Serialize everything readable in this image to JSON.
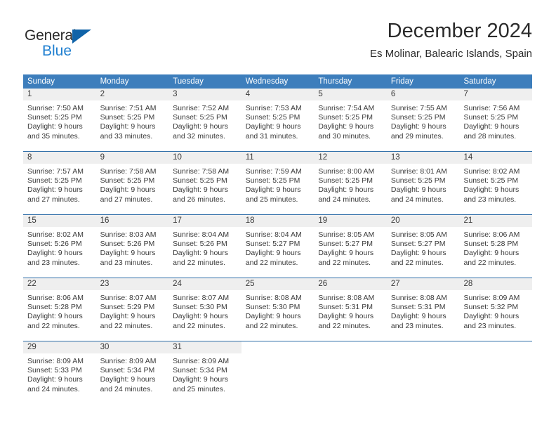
{
  "logo": {
    "word_one": "General",
    "word_two": "Blue",
    "triangle_icon": "triangle-icon",
    "accent_color": "#1063a8",
    "blue_text_color": "#1f7fd0"
  },
  "header": {
    "title": "December 2024",
    "subtitle": "Es Molinar, Balearic Islands, Spain"
  },
  "theme": {
    "header_row_bg": "#3d7ebc",
    "week_divider": "#2f6ea8",
    "day_band_bg": "#efefef",
    "text_color": "#3a3a3a"
  },
  "weekdays": [
    "Sunday",
    "Monday",
    "Tuesday",
    "Wednesday",
    "Thursday",
    "Friday",
    "Saturday"
  ],
  "weeks": [
    [
      {
        "day": "1",
        "sunrise": "Sunrise: 7:50 AM",
        "sunset": "Sunset: 5:25 PM",
        "daylight_line1": "Daylight: 9 hours",
        "daylight_line2": "and 35 minutes."
      },
      {
        "day": "2",
        "sunrise": "Sunrise: 7:51 AM",
        "sunset": "Sunset: 5:25 PM",
        "daylight_line1": "Daylight: 9 hours",
        "daylight_line2": "and 33 minutes."
      },
      {
        "day": "3",
        "sunrise": "Sunrise: 7:52 AM",
        "sunset": "Sunset: 5:25 PM",
        "daylight_line1": "Daylight: 9 hours",
        "daylight_line2": "and 32 minutes."
      },
      {
        "day": "4",
        "sunrise": "Sunrise: 7:53 AM",
        "sunset": "Sunset: 5:25 PM",
        "daylight_line1": "Daylight: 9 hours",
        "daylight_line2": "and 31 minutes."
      },
      {
        "day": "5",
        "sunrise": "Sunrise: 7:54 AM",
        "sunset": "Sunset: 5:25 PM",
        "daylight_line1": "Daylight: 9 hours",
        "daylight_line2": "and 30 minutes."
      },
      {
        "day": "6",
        "sunrise": "Sunrise: 7:55 AM",
        "sunset": "Sunset: 5:25 PM",
        "daylight_line1": "Daylight: 9 hours",
        "daylight_line2": "and 29 minutes."
      },
      {
        "day": "7",
        "sunrise": "Sunrise: 7:56 AM",
        "sunset": "Sunset: 5:25 PM",
        "daylight_line1": "Daylight: 9 hours",
        "daylight_line2": "and 28 minutes."
      }
    ],
    [
      {
        "day": "8",
        "sunrise": "Sunrise: 7:57 AM",
        "sunset": "Sunset: 5:25 PM",
        "daylight_line1": "Daylight: 9 hours",
        "daylight_line2": "and 27 minutes."
      },
      {
        "day": "9",
        "sunrise": "Sunrise: 7:58 AM",
        "sunset": "Sunset: 5:25 PM",
        "daylight_line1": "Daylight: 9 hours",
        "daylight_line2": "and 27 minutes."
      },
      {
        "day": "10",
        "sunrise": "Sunrise: 7:58 AM",
        "sunset": "Sunset: 5:25 PM",
        "daylight_line1": "Daylight: 9 hours",
        "daylight_line2": "and 26 minutes."
      },
      {
        "day": "11",
        "sunrise": "Sunrise: 7:59 AM",
        "sunset": "Sunset: 5:25 PM",
        "daylight_line1": "Daylight: 9 hours",
        "daylight_line2": "and 25 minutes."
      },
      {
        "day": "12",
        "sunrise": "Sunrise: 8:00 AM",
        "sunset": "Sunset: 5:25 PM",
        "daylight_line1": "Daylight: 9 hours",
        "daylight_line2": "and 24 minutes."
      },
      {
        "day": "13",
        "sunrise": "Sunrise: 8:01 AM",
        "sunset": "Sunset: 5:25 PM",
        "daylight_line1": "Daylight: 9 hours",
        "daylight_line2": "and 24 minutes."
      },
      {
        "day": "14",
        "sunrise": "Sunrise: 8:02 AM",
        "sunset": "Sunset: 5:25 PM",
        "daylight_line1": "Daylight: 9 hours",
        "daylight_line2": "and 23 minutes."
      }
    ],
    [
      {
        "day": "15",
        "sunrise": "Sunrise: 8:02 AM",
        "sunset": "Sunset: 5:26 PM",
        "daylight_line1": "Daylight: 9 hours",
        "daylight_line2": "and 23 minutes."
      },
      {
        "day": "16",
        "sunrise": "Sunrise: 8:03 AM",
        "sunset": "Sunset: 5:26 PM",
        "daylight_line1": "Daylight: 9 hours",
        "daylight_line2": "and 23 minutes."
      },
      {
        "day": "17",
        "sunrise": "Sunrise: 8:04 AM",
        "sunset": "Sunset: 5:26 PM",
        "daylight_line1": "Daylight: 9 hours",
        "daylight_line2": "and 22 minutes."
      },
      {
        "day": "18",
        "sunrise": "Sunrise: 8:04 AM",
        "sunset": "Sunset: 5:27 PM",
        "daylight_line1": "Daylight: 9 hours",
        "daylight_line2": "and 22 minutes."
      },
      {
        "day": "19",
        "sunrise": "Sunrise: 8:05 AM",
        "sunset": "Sunset: 5:27 PM",
        "daylight_line1": "Daylight: 9 hours",
        "daylight_line2": "and 22 minutes."
      },
      {
        "day": "20",
        "sunrise": "Sunrise: 8:05 AM",
        "sunset": "Sunset: 5:27 PM",
        "daylight_line1": "Daylight: 9 hours",
        "daylight_line2": "and 22 minutes."
      },
      {
        "day": "21",
        "sunrise": "Sunrise: 8:06 AM",
        "sunset": "Sunset: 5:28 PM",
        "daylight_line1": "Daylight: 9 hours",
        "daylight_line2": "and 22 minutes."
      }
    ],
    [
      {
        "day": "22",
        "sunrise": "Sunrise: 8:06 AM",
        "sunset": "Sunset: 5:28 PM",
        "daylight_line1": "Daylight: 9 hours",
        "daylight_line2": "and 22 minutes."
      },
      {
        "day": "23",
        "sunrise": "Sunrise: 8:07 AM",
        "sunset": "Sunset: 5:29 PM",
        "daylight_line1": "Daylight: 9 hours",
        "daylight_line2": "and 22 minutes."
      },
      {
        "day": "24",
        "sunrise": "Sunrise: 8:07 AM",
        "sunset": "Sunset: 5:30 PM",
        "daylight_line1": "Daylight: 9 hours",
        "daylight_line2": "and 22 minutes."
      },
      {
        "day": "25",
        "sunrise": "Sunrise: 8:08 AM",
        "sunset": "Sunset: 5:30 PM",
        "daylight_line1": "Daylight: 9 hours",
        "daylight_line2": "and 22 minutes."
      },
      {
        "day": "26",
        "sunrise": "Sunrise: 8:08 AM",
        "sunset": "Sunset: 5:31 PM",
        "daylight_line1": "Daylight: 9 hours",
        "daylight_line2": "and 22 minutes."
      },
      {
        "day": "27",
        "sunrise": "Sunrise: 8:08 AM",
        "sunset": "Sunset: 5:31 PM",
        "daylight_line1": "Daylight: 9 hours",
        "daylight_line2": "and 23 minutes."
      },
      {
        "day": "28",
        "sunrise": "Sunrise: 8:09 AM",
        "sunset": "Sunset: 5:32 PM",
        "daylight_line1": "Daylight: 9 hours",
        "daylight_line2": "and 23 minutes."
      }
    ],
    [
      {
        "day": "29",
        "sunrise": "Sunrise: 8:09 AM",
        "sunset": "Sunset: 5:33 PM",
        "daylight_line1": "Daylight: 9 hours",
        "daylight_line2": "and 24 minutes."
      },
      {
        "day": "30",
        "sunrise": "Sunrise: 8:09 AM",
        "sunset": "Sunset: 5:34 PM",
        "daylight_line1": "Daylight: 9 hours",
        "daylight_line2": "and 24 minutes."
      },
      {
        "day": "31",
        "sunrise": "Sunrise: 8:09 AM",
        "sunset": "Sunset: 5:34 PM",
        "daylight_line1": "Daylight: 9 hours",
        "daylight_line2": "and 25 minutes."
      },
      {
        "day": "",
        "sunrise": "",
        "sunset": "",
        "daylight_line1": "",
        "daylight_line2": ""
      },
      {
        "day": "",
        "sunrise": "",
        "sunset": "",
        "daylight_line1": "",
        "daylight_line2": ""
      },
      {
        "day": "",
        "sunrise": "",
        "sunset": "",
        "daylight_line1": "",
        "daylight_line2": ""
      },
      {
        "day": "",
        "sunrise": "",
        "sunset": "",
        "daylight_line1": "",
        "daylight_line2": ""
      }
    ]
  ]
}
